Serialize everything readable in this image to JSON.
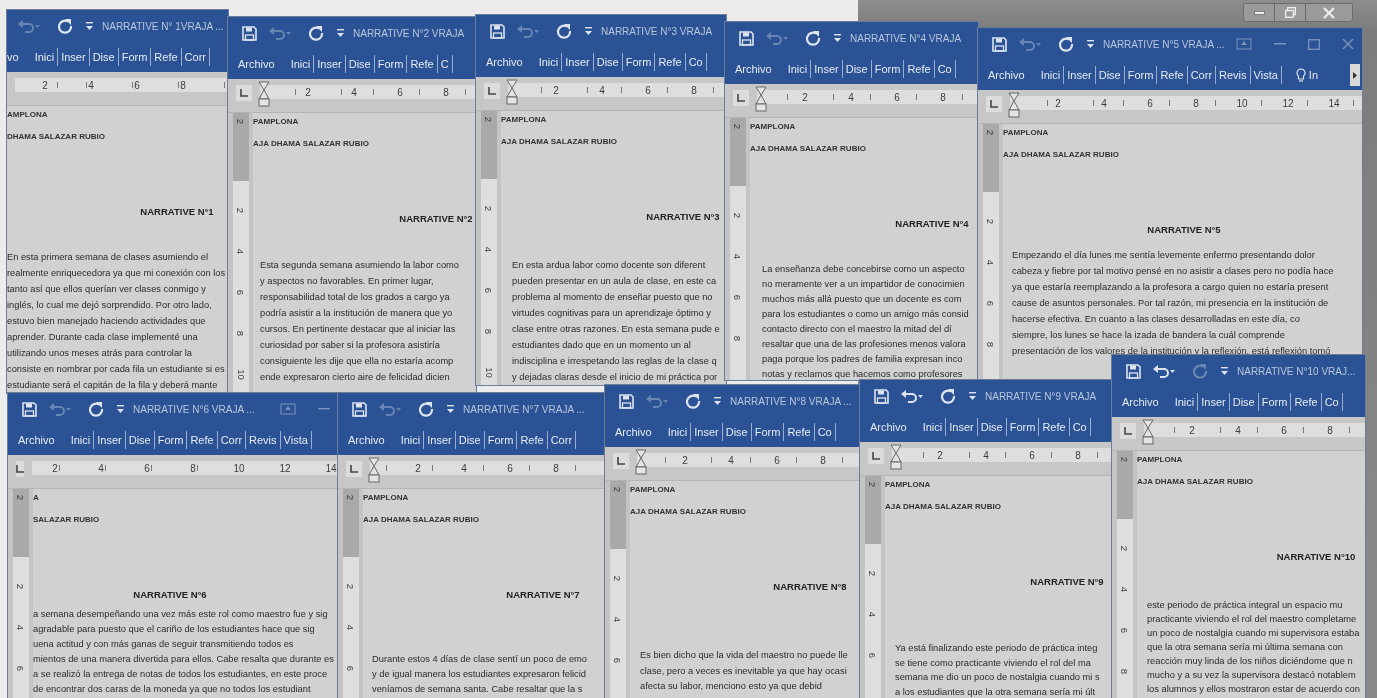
{
  "windows": [
    {
      "title": "NARRATIVE N° 1VRAJA ...",
      "undo_enabled": false,
      "redo_enabled": true,
      "tabs": [
        "vo",
        "Inici",
        "Inser",
        "Dise",
        "Form",
        "Refe",
        "Corr"
      ],
      "hruler": [
        "2",
        "4",
        "6",
        "8"
      ],
      "header_lines": [
        "AMPLONA",
        "DHAMA SALAZAR RUBIO"
      ],
      "heading": "NARRATIVE N°1",
      "body": [
        "En esta primera semana de clases asumiendo el",
        "realmente enriquecedora ya que mi conexión con los",
        "tanto así que ellos querían ver clases conmigo y",
        "inglés, lo cual me dejó sorprendido. Por otro lado,",
        "estuvo bien manejado haciendo actividades que",
        "aprender. Durante cada clase implementé una",
        "utilizando unos meses atrás para controlar la",
        "consiste en nombrar por cada fila un estudiante si es",
        "estudiante será el capitán de la fila y deberá mante"
      ]
    },
    {
      "title": "NARRATIVE N°2 VRAJA",
      "undo_enabled": false,
      "redo_enabled": true,
      "tabs": [
        "Archivo",
        "Inici",
        "Inser",
        "Dise",
        "Form",
        "Refe",
        "C"
      ],
      "hruler": [
        "2",
        "4",
        "6",
        "8"
      ],
      "vruler": [
        "2",
        "2",
        "4",
        "6",
        "8",
        "10"
      ],
      "header_lines": [
        "PAMPLONA",
        "AJA DHAMA SALAZAR RUBIO"
      ],
      "heading": "NARRATIVE N°2",
      "body": [
        "Esta segunda semana asumiendo la labor como",
        "y aspectos no favorables. En primer lugar,",
        "responsabilidad total de los grados a cargo ya",
        "podría asistir a la institución de manera que yo",
        "cursos. En pertinente destacar que al iniciar las",
        "curiosidad por saber si la profesora asistiría",
        "consiguiente les dije que ella no estaría acomp",
        "ende expresaron cierto aire de felicidad dicien"
      ]
    },
    {
      "title": "NARRATIVE N°3 VRAJA",
      "undo_enabled": false,
      "redo_enabled": true,
      "tabs": [
        "Archivo",
        "Inici",
        "Inser",
        "Dise",
        "Form",
        "Refe",
        "Co"
      ],
      "hruler": [
        "2",
        "4",
        "6",
        "8"
      ],
      "vruler": [
        "2",
        "2",
        "4",
        "6",
        "8",
        "10"
      ],
      "header_lines": [
        "PAMPLONA",
        "AJA DHAMA SALAZAR RUBIO"
      ],
      "heading": "NARRATIVE N°3",
      "body": [
        "En esta ardua labor como docente son diferent",
        "pueden presentar en un aula de clase, en este ca",
        "problema al momento de enseñar puesto que no",
        "virtudes cognitivas para un aprendizaje óptimo y",
        "clase entre otras razones. En esta semana pude e",
        "estudiantes dado que en un momento un al",
        "indisciplina e irrespetando las reglas de la clase q",
        "y dejadas claras desde el inicio de mi práctica por"
      ]
    },
    {
      "title": "NARRATIVE N°4 VRAJA",
      "undo_enabled": false,
      "redo_enabled": true,
      "tabs": [
        "Archivo",
        "Inici",
        "Inser",
        "Dise",
        "Form",
        "Refe",
        "Co"
      ],
      "hruler": [
        "2",
        "4",
        "6",
        "8"
      ],
      "vruler": [
        "2",
        "2",
        "4",
        "6",
        "8"
      ],
      "header_lines": [
        "PAMPLONA",
        "AJA DHAMA SALAZAR RUBIO"
      ],
      "heading": "NARRATIVE N°4",
      "body": [
        "La enseñanza debe concebirse como un aspecto",
        "no meramente ver a un impartidor de conocimien",
        "muchos más allá puesto que un docente es com",
        "para los estudiantes o como un amigo más consid",
        "contacto directo con el maestro la mitad del dí",
        "resaltar que una de las profesiones menos valora",
        "paga porque los padres de familia expresan inco",
        "notas y reclamos que hacemos como profesores"
      ]
    },
    {
      "title": "NARRATIVE N°5 VRAJA ...",
      "undo_enabled": false,
      "redo_enabled": true,
      "tabs": [
        "Archivo",
        "Inici",
        "Inser",
        "Dise",
        "Form",
        "Refe",
        "Corr",
        "Revis",
        "Vista"
      ],
      "tell_me": "In",
      "tabs_overflow": true,
      "hruler": [
        "2",
        "4",
        "6",
        "8",
        "10",
        "12",
        "14"
      ],
      "vruler": [
        "2",
        "2",
        "4",
        "6",
        "8"
      ],
      "header_lines": [
        "PAMPLONA",
        "AJA DHAMA SALAZAR RUBIO"
      ],
      "heading": "NARRATIVE N°5",
      "body": [
        "Empezando el día lunes me sentía levemente enfermo presentando dolor",
        "cabeza y fiebre por tal motivo pensé en no asistir a clases pero no podía hace",
        "ya que estaría reemplazando a la profesora a cargo quien no estaría present",
        "cause de asuntos personales. Por tal razón, mi presencia en la institución de",
        "hacerse efectiva. En cuanto a las clases desarrolladas en este día, co",
        "siempre, los lunes se hace la izada de bandera la cuál comprende",
        "presentación de los valores de la institución y la reflexión, está reflexión tomó"
      ]
    },
    {
      "title": "NARRATIVE N°6 VRAJA ...",
      "undo_enabled": false,
      "redo_enabled": true,
      "tabs": [
        "Archivo",
        "Inici",
        "Inser",
        "Dise",
        "Form",
        "Refe",
        "Corr",
        "Revis",
        "Vista"
      ],
      "hruler": [
        "2",
        "4",
        "6",
        "8",
        "10",
        "12",
        "14"
      ],
      "vruler": [
        "2",
        "2",
        "4",
        "6"
      ],
      "header_lines": [
        "A",
        "SALAZAR RUBIO"
      ],
      "heading": "NARRATIVE N°6",
      "body": [
        "a semana desempeñando una vez más este rol como maestro fue y sig",
        "agradable para puesto que el cariño de los estudiantes hace que sig",
        "uena actitud y con más ganas de seguir transmitiendo todos es",
        "mientos de una manera divertida para ellos. Cabe resalta que durante es",
        "a se realizó la entrega de notas de todos los estudiantes, en este proce",
        "de encontrar dos caras de la moneda ya que no todos los estudiant"
      ]
    },
    {
      "title": "NARRATIVE N°7 VRAJA ...",
      "undo_enabled": false,
      "redo_enabled": true,
      "tabs": [
        "Archivo",
        "Inici",
        "Inser",
        "Dise",
        "Form",
        "Refe",
        "Corr"
      ],
      "hruler": [
        "2",
        "4",
        "6",
        "8"
      ],
      "vruler": [
        "2",
        "2",
        "4",
        "6"
      ],
      "header_lines": [
        "PAMPLONA",
        "AJA DHAMA SALAZAR RUBIO"
      ],
      "heading": "NARRATIVE N°7",
      "body": [
        "Durante estos 4 días de clase sentí un poco de emo",
        "y de igual manera los estudiantes expresaron felicid",
        "veníamos de semana santa. Cabe resaltar que la s"
      ]
    },
    {
      "title": "NARRATIVE N°8 VRAJA ...",
      "undo_enabled": false,
      "redo_enabled": true,
      "tabs": [
        "Archivo",
        "Inici",
        "Inser",
        "Dise",
        "Form",
        "Refe",
        "Co"
      ],
      "hruler": [
        "2",
        "4",
        "6",
        "8"
      ],
      "vruler": [
        "2",
        "2",
        "4",
        "6"
      ],
      "header_lines": [
        "PAMPLONA",
        "AJA DHAMA SALAZAR RUBIO"
      ],
      "heading": "NARRATIVE N°8",
      "body": [
        "Es bien dicho que la vida del maestro no puede lle",
        "clase, pero a veces es inevitable ya que hay ocasi",
        "afecta su labor, menciono esto ya que debid"
      ]
    },
    {
      "title": "NARRATIVE N°9 VRAJA",
      "undo_enabled": true,
      "redo_enabled": true,
      "tabs": [
        "Archivo",
        "Inici",
        "Inser",
        "Dise",
        "Form",
        "Refe",
        "Co"
      ],
      "hruler": [
        "2",
        "4",
        "6",
        "8"
      ],
      "vruler": [
        "2",
        "2",
        "4",
        "6"
      ],
      "header_lines": [
        "PAMPLONA",
        "AJA DHAMA SALAZAR RUBIO"
      ],
      "heading": "NARRATIVE N°9",
      "body": [
        "Ya está finalizando este periodo de práctica integ",
        "se tiene como practicante viviendo el rol del ma",
        "semana me dio un poco de nostalgia cuando mi s",
        "a los estudiantes que la otra semana sería mi últ"
      ]
    },
    {
      "title": "NARRATIVE N°10 VRAJ...",
      "undo_enabled": true,
      "redo_enabled": false,
      "tabs": [
        "Archivo",
        "Inici",
        "Inser",
        "Dise",
        "Form",
        "Refe",
        "Co"
      ],
      "hruler": [
        "2",
        "4",
        "6",
        "8"
      ],
      "vruler": [
        "2",
        "2",
        "4",
        "6",
        "8"
      ],
      "header_lines": [
        "PAMPLONA",
        "AJA DHAMA SALAZAR RUBIO"
      ],
      "heading": "NARRATIVE N°10",
      "body": [
        "este periodo de práctica integral un espacio mu",
        "practicante viviendo el rol del maestro completame",
        "un poco de nostalgia cuando mi supervisora estaba",
        "que la otra semana sería mi última semana con",
        "reacción muy linda de los niños diciéndome que n",
        "mucho y a su vez la supervisora destacó notablem",
        "los alumnos y ellos mostraron estar de acuerdo con"
      ]
    }
  ]
}
